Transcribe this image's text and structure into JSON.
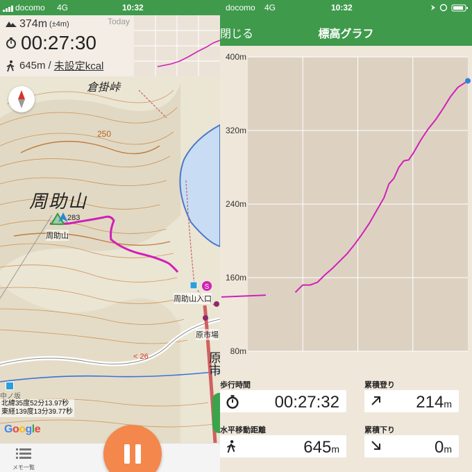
{
  "left": {
    "status": {
      "carrier": "docomo",
      "network": "4G",
      "time": "10:32"
    },
    "stats": {
      "elevation": "374m",
      "accuracy": "(±4m)",
      "elapsed": "00:27:30",
      "distance": "645m",
      "separator": "/",
      "calories": "未設定kcal",
      "today_label": "Today"
    },
    "map": {
      "place_name": "周助山",
      "summit_label": "周助山",
      "summit_elev": "283",
      "pass_label": "倉掛峠",
      "contour_label": "250",
      "trailhead_label": "周助山入口",
      "market_label": "原市場",
      "road_label": "26",
      "town_label": "原市",
      "small_label": "中ノ坂",
      "coord_lat": "北緯35度52分13.97秒",
      "coord_lon": "東経139度13分39.77秒",
      "google": "Google",
      "menu_label": "メモ一覧"
    }
  },
  "right": {
    "status": {
      "carrier": "docomo",
      "network": "4G",
      "time": "10:32"
    },
    "header": {
      "close": "閉じる",
      "title": "標高グラフ"
    },
    "cards": {
      "walk_time_label": "歩行時間",
      "walk_time": "00:27:32",
      "ascent_label": "累積登り",
      "ascent": "214",
      "ascent_unit": "m",
      "distance_label": "水平移動距離",
      "distance": "645",
      "distance_unit": "m",
      "descent_label": "累積下り",
      "descent": "0",
      "descent_unit": "m"
    }
  },
  "colors": {
    "accent_green": "#3f9a4c",
    "track": "#d020b8",
    "pause": "#f4874c"
  },
  "chart_data": {
    "type": "line",
    "title": "",
    "xlabel": "",
    "ylabel": "",
    "ylim": [
      80,
      400
    ],
    "yticks": [
      "80m",
      "160m",
      "240m",
      "320m",
      "400m"
    ],
    "grid": true,
    "series": [
      {
        "values": [
          [
            0,
            139
          ],
          [
            0.18,
            141
          ],
          [
            0.3,
            144
          ],
          [
            0.33,
            152
          ],
          [
            0.36,
            152
          ],
          [
            0.39,
            155
          ],
          [
            0.42,
            163
          ],
          [
            0.45,
            170
          ],
          [
            0.48,
            178
          ],
          [
            0.51,
            186
          ],
          [
            0.54,
            196
          ],
          [
            0.57,
            207
          ],
          [
            0.6,
            219
          ],
          [
            0.63,
            233
          ],
          [
            0.66,
            247
          ],
          [
            0.68,
            262
          ],
          [
            0.7,
            268
          ],
          [
            0.72,
            280
          ],
          [
            0.74,
            287
          ],
          [
            0.76,
            288
          ],
          [
            0.78,
            296
          ],
          [
            0.81,
            310
          ],
          [
            0.84,
            322
          ],
          [
            0.87,
            332
          ],
          [
            0.9,
            344
          ],
          [
            0.93,
            357
          ],
          [
            0.96,
            367
          ],
          [
            1.0,
            374
          ]
        ],
        "gap_after_index": 1
      }
    ]
  }
}
